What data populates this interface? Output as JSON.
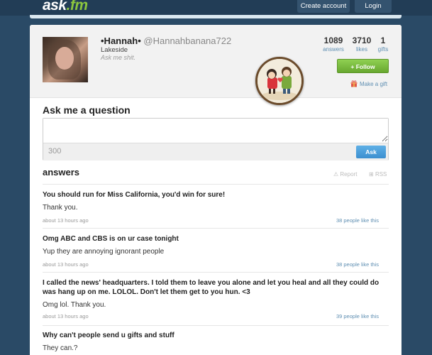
{
  "header": {
    "logo_main": "ask",
    "logo_dot": ".fm",
    "create_account_label": "Create account",
    "login_label": "Login"
  },
  "profile": {
    "display_name": "•Hannah•",
    "username": "@Hannahbanana722",
    "location": "Lakeside",
    "bio": "Ask me shit.",
    "stats": [
      {
        "value": "1089",
        "label": "answers"
      },
      {
        "value": "3710",
        "label": "likes"
      },
      {
        "value": "1",
        "label": "gifts"
      }
    ],
    "follow_label": "+ Follow",
    "make_gift_label": "Make a gift"
  },
  "ask": {
    "title": "Ask me a question",
    "char_count": "300",
    "button_label": "Ask"
  },
  "answers": {
    "title": "answers",
    "report_label": "Report",
    "rss_label": "RSS",
    "items": [
      {
        "question": "You should run for Miss California, you'd win for sure!",
        "answer": "Thank you.",
        "time": "about 13 hours ago",
        "likes": "38 people like this"
      },
      {
        "question": "Omg ABC and CBS is on ur case tonight",
        "answer": "Yup they are annoying ignorant people",
        "time": "about 13 hours ago",
        "likes": "38 people like this"
      },
      {
        "question": "I called the news' headquarters. I told them to leave you alone and let you heal and all they could do was hang up on me. LOLOL. Don't let them get to you hun. <3",
        "answer": "Omg lol. Thank you.",
        "time": "about 13 hours ago",
        "likes": "39 people like this"
      },
      {
        "question": "Why can't people send u gifts and stuff",
        "answer": "They can.?",
        "time": "",
        "likes": ""
      }
    ]
  },
  "colors": {
    "page_bg": "#2a4a66",
    "follow_green": "#6cb33f",
    "ask_blue": "#3c8fd0",
    "link_blue": "#5f8fb2"
  }
}
